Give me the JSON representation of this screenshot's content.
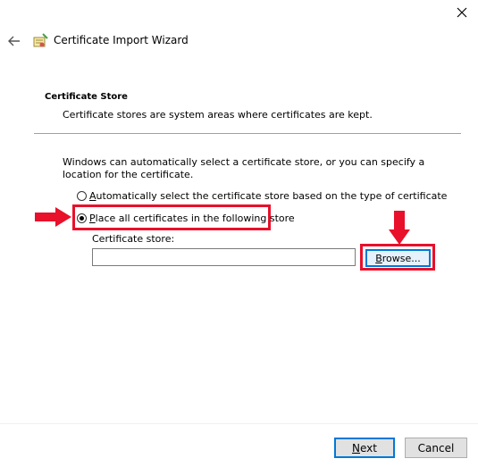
{
  "window": {
    "title": "Certificate Import Wizard",
    "close_icon": "close-icon",
    "back_icon": "back-arrow-icon",
    "wizard_icon": "certificate-wizard-icon"
  },
  "section": {
    "title": "Certificate Store",
    "description": "Certificate stores are system areas where certificates are kept."
  },
  "intro": "Windows can automatically select a certificate store, or you can specify a location for the certificate.",
  "options": [
    {
      "first_letter": "A",
      "rest": "utomatically select the certificate store based on the type of certificate",
      "checked": false
    },
    {
      "first_letter": "P",
      "rest": "lace all certificates in the following store",
      "checked": true
    }
  ],
  "store": {
    "label": "Certificate store:",
    "value": ""
  },
  "browse": {
    "first_letter": "B",
    "rest": "rowse..."
  },
  "footer": {
    "next": {
      "first_letter": "N",
      "rest": "ext"
    },
    "cancel": "Cancel"
  },
  "colors": {
    "annotation_red": "#e8102a",
    "focus_blue": "#0078d7"
  }
}
